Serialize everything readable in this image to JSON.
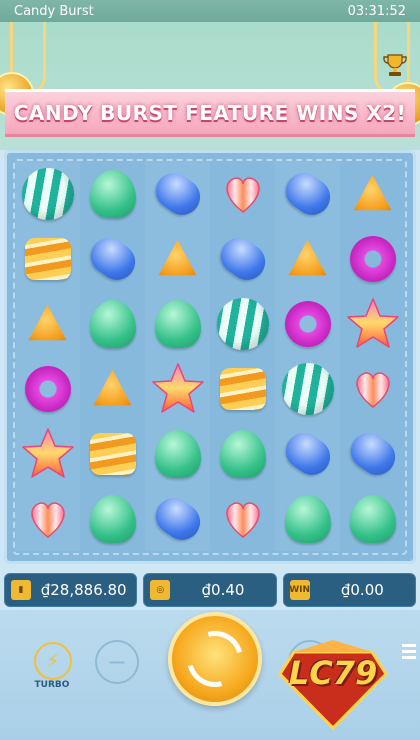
{
  "window": {
    "title": "Candy Burst",
    "clock": "03:31:52"
  },
  "banner": {
    "text": "CANDY BURST FEATURE WINS X2!"
  },
  "board": {
    "rows": [
      [
        "ball",
        "gum",
        "bean",
        "heart",
        "bean",
        "tri"
      ],
      [
        "caramel",
        "bean",
        "tri",
        "bean",
        "tri",
        "donut"
      ],
      [
        "tri",
        "gum",
        "gum",
        "ball",
        "donut",
        "star"
      ],
      [
        "donut",
        "tri",
        "star",
        "caramel",
        "ball",
        "heart"
      ],
      [
        "star",
        "caramel",
        "gum",
        "gum",
        "bean",
        "bean"
      ],
      [
        "heart",
        "gum",
        "bean",
        "heart",
        "gum",
        "gum"
      ]
    ]
  },
  "status": {
    "balance": "₫28,886.80",
    "bet": "₫0.40",
    "win": "₫0.00",
    "win_icon_text": "WIN"
  },
  "controls": {
    "turbo_label": "TURBO",
    "minus": "−",
    "plus": "+"
  },
  "logo": {
    "text": "LC79"
  },
  "colors": {
    "banner": "#f6a6bb",
    "board": "#86b9dc",
    "stat_bg": "#2b5f82",
    "spin": "#f6a91f"
  }
}
